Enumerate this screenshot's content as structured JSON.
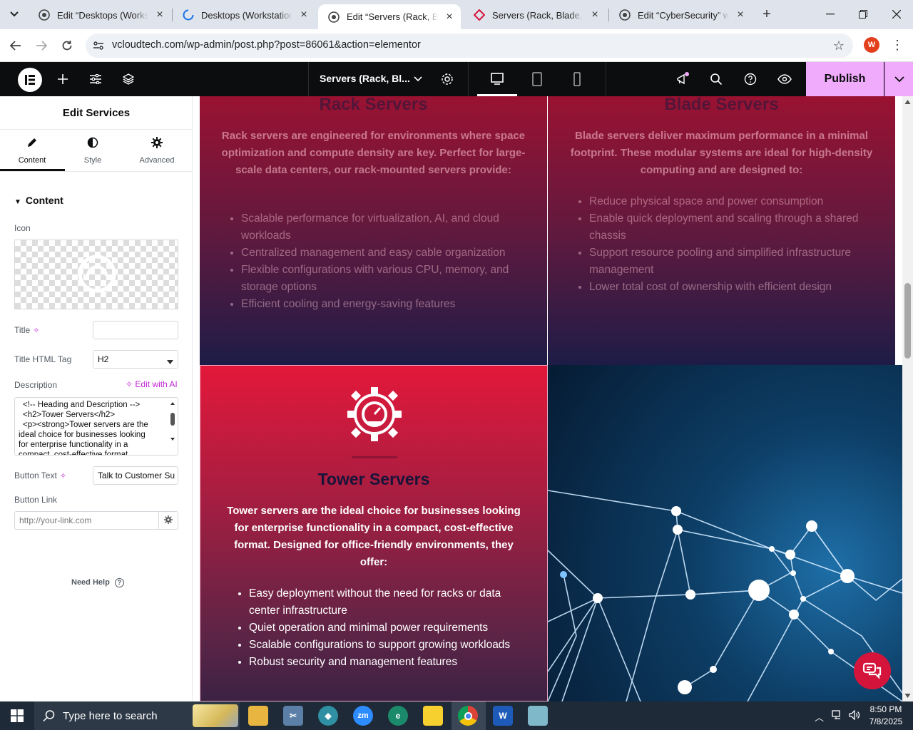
{
  "browser": {
    "tabs": [
      {
        "label": "Edit “Desktops (Workstations…",
        "active": false
      },
      {
        "label": "Desktops (Workstations, …",
        "active": false
      },
      {
        "label": "Edit “Servers (Rack, Blade…",
        "active": true
      },
      {
        "label": "Servers (Rack, Blade, Tow…",
        "active": false
      },
      {
        "label": "Edit “CyberSecurity” with…",
        "active": false
      }
    ],
    "url": "vcloudtech.com/wp-admin/post.php?post=86061&action=elementor",
    "profile_initial": "W"
  },
  "editor": {
    "doc_title": "Servers (Rack, Bl...",
    "publish_label": "Publish"
  },
  "panel": {
    "title": "Edit Services",
    "tabs": [
      {
        "label": "Content",
        "icon": "pencil-icon"
      },
      {
        "label": "Style",
        "icon": "half-circle-icon"
      },
      {
        "label": "Advanced",
        "icon": "gear-icon"
      }
    ],
    "section": "Content",
    "icon_label": "Icon",
    "title_label": "Title",
    "title_value": "",
    "tag_label": "Title HTML Tag",
    "tag_value": "H2",
    "description_label": "Description",
    "edit_ai": "Edit with AI",
    "description_lines": [
      "<!-- Heading and Description -->",
      "<h2>Tower Servers</h2>",
      "<p><strong>Tower servers are the",
      "ideal choice for businesses looking",
      "for enterprise functionality in a",
      "compact, cost-effective format."
    ],
    "button_text_label": "Button Text",
    "button_text_value": "Talk to Customer Su",
    "button_link_label": "Button Link",
    "button_link_placeholder": "http://your-link.com",
    "need_help": "Need Help"
  },
  "canvas": {
    "rack": {
      "title": "Rack Servers",
      "desc": "Rack servers are engineered for environments where space optimization and compute density are key. Perfect for large-scale data centers, our rack-mounted servers provide:",
      "items": [
        "Scalable performance for virtualization, AI, and cloud workloads",
        "Centralized management and easy cable organization",
        "Flexible configurations with various CPU, memory, and storage options",
        "Efficient cooling and energy-saving features"
      ]
    },
    "blade": {
      "title": "Blade Servers",
      "desc": "Blade servers deliver maximum performance in a minimal footprint. These modular systems are ideal for high-density computing and are designed to:",
      "items": [
        "Reduce physical space and power consumption",
        "Enable quick deployment and scaling through a shared chassis",
        "Support resource pooling and simplified infrastructure management",
        "Lower total cost of ownership with efficient design"
      ]
    },
    "tower": {
      "title": "Tower Servers",
      "desc": "Tower servers are the ideal choice for businesses looking for enterprise functionality in a compact, cost-effective format. Designed for office-friendly environments, they offer:",
      "items": [
        "Easy deployment without the need for racks or data center infrastructure",
        "Quiet operation and minimal power requirements",
        "Scalable configurations to support growing workloads",
        "Robust security and management features"
      ]
    }
  },
  "taskbar": {
    "search_placeholder": "Type here to search",
    "time": "8:50 PM",
    "date": "7/8/2025"
  },
  "colors": {
    "accent": "#f0abfc",
    "tower_top": "#e3183a",
    "chat": "#d5143b"
  }
}
